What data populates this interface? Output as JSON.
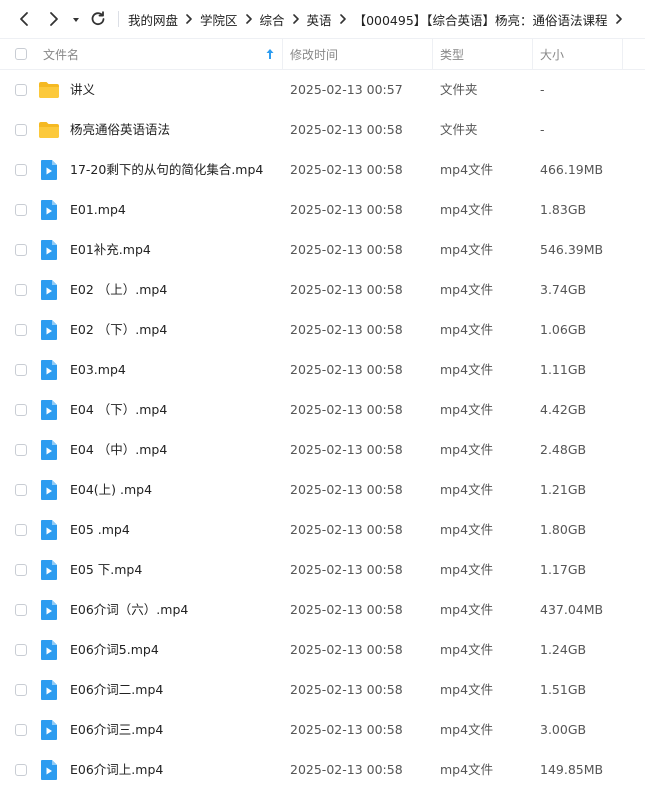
{
  "breadcrumb": [
    "我的网盘",
    "学院区",
    "综合",
    "英语",
    "【000495】【综合英语】杨亮：通俗语法课程"
  ],
  "header": {
    "name": "文件名",
    "modified": "修改时间",
    "type": "类型",
    "size": "大小"
  },
  "colors": {
    "folder": "#f5b922",
    "video": "#2d9cf0",
    "sort_arrow": "#2d9cf0"
  },
  "files": [
    {
      "name": "讲义",
      "date": "2025-02-13 00:57",
      "type": "文件夹",
      "size": "-",
      "icon": "folder-icon"
    },
    {
      "name": "杨亮通俗英语语法",
      "date": "2025-02-13 00:58",
      "type": "文件夹",
      "size": "-",
      "icon": "folder-icon"
    },
    {
      "name": "17-20剩下的从句的简化集合.mp4",
      "date": "2025-02-13 00:58",
      "type": "mp4文件",
      "size": "466.19MB",
      "icon": "video-file-icon"
    },
    {
      "name": "E01.mp4",
      "date": "2025-02-13 00:58",
      "type": "mp4文件",
      "size": "1.83GB",
      "icon": "video-file-icon"
    },
    {
      "name": "E01补充.mp4",
      "date": "2025-02-13 00:58",
      "type": "mp4文件",
      "size": "546.39MB",
      "icon": "video-file-icon"
    },
    {
      "name": "E02 （上）.mp4",
      "date": "2025-02-13 00:58",
      "type": "mp4文件",
      "size": "3.74GB",
      "icon": "video-file-icon"
    },
    {
      "name": "E02 （下）.mp4",
      "date": "2025-02-13 00:58",
      "type": "mp4文件",
      "size": "1.06GB",
      "icon": "video-file-icon"
    },
    {
      "name": "E03.mp4",
      "date": "2025-02-13 00:58",
      "type": "mp4文件",
      "size": "1.11GB",
      "icon": "video-file-icon"
    },
    {
      "name": "E04 （下）.mp4",
      "date": "2025-02-13 00:58",
      "type": "mp4文件",
      "size": "4.42GB",
      "icon": "video-file-icon"
    },
    {
      "name": "E04 （中）.mp4",
      "date": "2025-02-13 00:58",
      "type": "mp4文件",
      "size": "2.48GB",
      "icon": "video-file-icon"
    },
    {
      "name": "E04(上) .mp4",
      "date": "2025-02-13 00:58",
      "type": "mp4文件",
      "size": "1.21GB",
      "icon": "video-file-icon"
    },
    {
      "name": "E05 .mp4",
      "date": "2025-02-13 00:58",
      "type": "mp4文件",
      "size": "1.80GB",
      "icon": "video-file-icon"
    },
    {
      "name": "E05 下.mp4",
      "date": "2025-02-13 00:58",
      "type": "mp4文件",
      "size": "1.17GB",
      "icon": "video-file-icon"
    },
    {
      "name": "E06介词（六）.mp4",
      "date": "2025-02-13 00:58",
      "type": "mp4文件",
      "size": "437.04MB",
      "icon": "video-file-icon"
    },
    {
      "name": "E06介词5.mp4",
      "date": "2025-02-13 00:58",
      "type": "mp4文件",
      "size": "1.24GB",
      "icon": "video-file-icon"
    },
    {
      "name": "E06介词二.mp4",
      "date": "2025-02-13 00:58",
      "type": "mp4文件",
      "size": "1.51GB",
      "icon": "video-file-icon"
    },
    {
      "name": "E06介词三.mp4",
      "date": "2025-02-13 00:58",
      "type": "mp4文件",
      "size": "3.00GB",
      "icon": "video-file-icon"
    },
    {
      "name": "E06介词上.mp4",
      "date": "2025-02-13 00:58",
      "type": "mp4文件",
      "size": "149.85MB",
      "icon": "video-file-icon"
    }
  ]
}
